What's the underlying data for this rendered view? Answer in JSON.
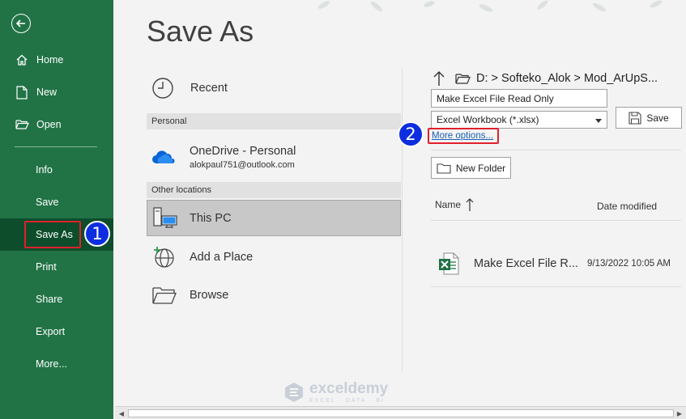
{
  "sidebar": {
    "items": [
      {
        "key": "home",
        "label": "Home",
        "icon": "home-icon"
      },
      {
        "key": "new",
        "label": "New",
        "icon": "new-document-icon"
      },
      {
        "key": "open",
        "label": "Open",
        "icon": "open-folder-icon"
      },
      {
        "key": "info",
        "label": "Info"
      },
      {
        "key": "save",
        "label": "Save"
      },
      {
        "key": "save_as",
        "label": "Save As",
        "active": true
      },
      {
        "key": "print",
        "label": "Print"
      },
      {
        "key": "share",
        "label": "Share"
      },
      {
        "key": "export",
        "label": "Export"
      },
      {
        "key": "more",
        "label": "More..."
      }
    ]
  },
  "page_title": "Save As",
  "locations": {
    "recent": "Recent",
    "personal_header": "Personal",
    "onedrive_label": "OneDrive - Personal",
    "onedrive_account": "alokpaul751@outlook.com",
    "other_header": "Other locations",
    "this_pc": "This PC",
    "add_place": "Add a Place",
    "browse": "Browse"
  },
  "save_panel": {
    "path": "D: > Softeko_Alok > Mod_ArUpS...",
    "filename_value": "Make Excel File Read Only",
    "file_type": "Excel Workbook (*.xlsx)",
    "save_label": "Save",
    "more_options": "More options...",
    "new_folder": "New Folder",
    "col_name": "Name",
    "col_date": "Date modified",
    "files": [
      {
        "name": "Make Excel File R...",
        "date": "9/13/2022 10:05 AM"
      }
    ]
  },
  "annotations": {
    "step1": "1",
    "step2": "2"
  },
  "watermark": {
    "brand": "exceldemy",
    "tagline": "EXCEL · DATA · BI"
  },
  "colors": {
    "sidebar": "#217346",
    "sidebar_active": "#0d4d2c",
    "highlight": "#e0202c",
    "badge": "#0d2ee0",
    "link": "#1a5fb4"
  }
}
